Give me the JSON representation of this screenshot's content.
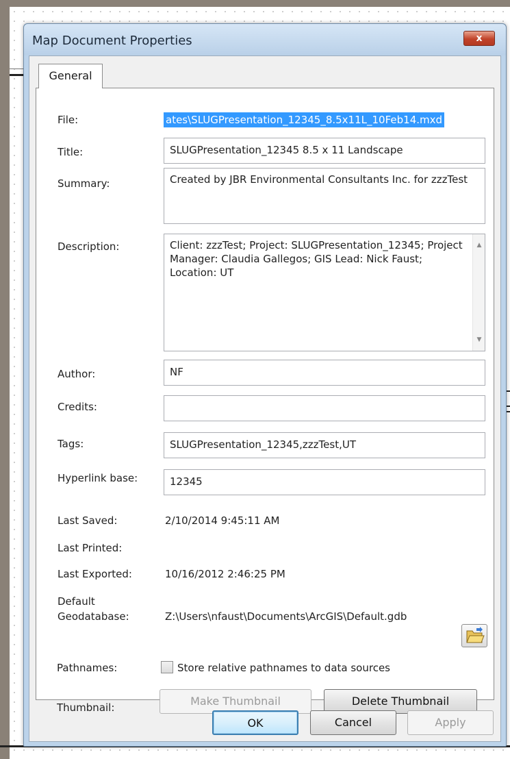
{
  "dialog": {
    "title": "Map Document Properties",
    "close_label": "x",
    "tab": "General"
  },
  "fields": {
    "file_label": "File:",
    "file_value": "ates\\SLUGPresentation_12345_8.5x11L_10Feb14.mxd",
    "title_label": "Title:",
    "title_value": "SLUGPresentation_12345 8.5 x 11 Landscape",
    "summary_label": "Summary:",
    "summary_value": "Created by JBR Environmental Consultants Inc. for zzzTest",
    "description_label": "Description:",
    "description_value": "Client: zzzTest; Project: SLUGPresentation_12345; Project Manager: Claudia Gallegos; GIS Lead: Nick Faust; Location: UT",
    "author_label": "Author:",
    "author_value": "NF",
    "credits_label": "Credits:",
    "credits_value": "",
    "tags_label": "Tags:",
    "tags_value": "SLUGPresentation_12345,zzzTest,UT",
    "hyperlink_label": "Hyperlink base:",
    "hyperlink_value": "12345"
  },
  "info": {
    "last_saved_label": "Last Saved:",
    "last_saved_value": "2/10/2014 9:45:11 AM",
    "last_printed_label": "Last Printed:",
    "last_printed_value": "",
    "last_exported_label": "Last Exported:",
    "last_exported_value": "10/16/2012 2:46:25 PM",
    "default_gdb_label_1": "Default",
    "default_gdb_label_2": "Geodatabase:",
    "default_gdb_value": "Z:\\Users\\nfaust\\Documents\\ArcGIS\\Default.gdb",
    "pathnames_label": "Pathnames:",
    "pathnames_checkbox_label": "Store relative pathnames to data sources",
    "pathnames_checked": false,
    "thumbnail_label": "Thumbnail:",
    "make_thumbnail": "Make Thumbnail",
    "delete_thumbnail": "Delete Thumbnail"
  },
  "buttons": {
    "ok": "OK",
    "cancel": "Cancel",
    "apply": "Apply"
  },
  "icons": {
    "close": "close-icon",
    "folder": "folder-open-icon",
    "scroll_up": "scroll-up-icon",
    "scroll_down": "scroll-down-icon"
  }
}
